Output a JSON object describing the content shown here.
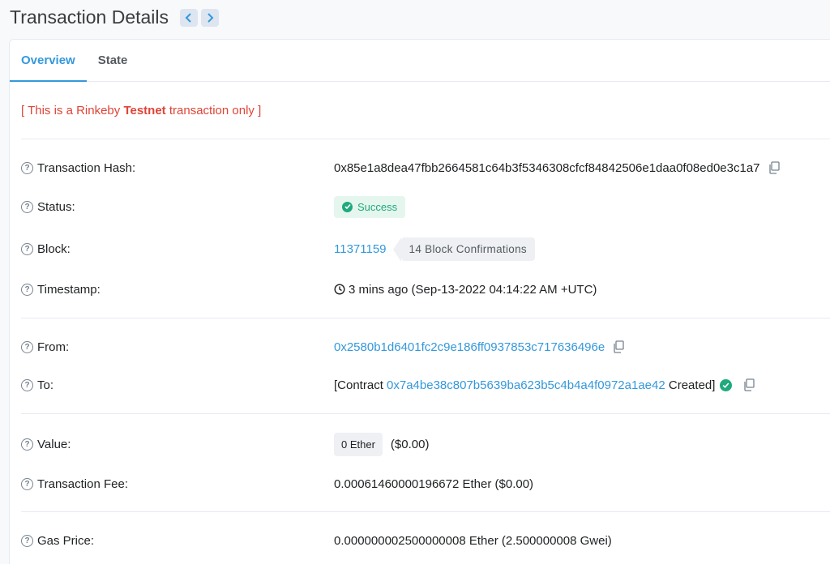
{
  "header": {
    "title": "Transaction Details"
  },
  "tabs": [
    {
      "label": "Overview"
    },
    {
      "label": "State"
    }
  ],
  "notice": {
    "prefix": "[ This is a Rinkeby ",
    "bold": "Testnet",
    "suffix": " transaction only ]"
  },
  "fields": {
    "hash": {
      "label": "Transaction Hash:",
      "value": "0x85e1a8dea47fbb2664581c64b3f5346308cfcf84842506e1daa0f08ed0e3c1a7"
    },
    "status": {
      "label": "Status:",
      "value": "Success"
    },
    "block": {
      "label": "Block:",
      "value": "11371159",
      "confirmations": "14 Block Confirmations"
    },
    "timestamp": {
      "label": "Timestamp:",
      "value": "3 mins ago (Sep-13-2022 04:14:22 AM +UTC)"
    },
    "from": {
      "label": "From:",
      "value": "0x2580b1d6401fc2c9e186ff0937853c717636496e"
    },
    "to": {
      "label": "To:",
      "prefix": "[Contract ",
      "address": "0x7a4be38c807b5639ba623b5c4b4a4f0972a1ae42",
      "suffix": " Created]"
    },
    "value": {
      "label": "Value:",
      "badge": "0 Ether",
      "usd": "($0.00)"
    },
    "fee": {
      "label": "Transaction Fee:",
      "value": "0.00061460000196672 Ether ($0.00)"
    },
    "gas": {
      "label": "Gas Price:",
      "value": "0.000000002500000008 Ether (2.500000008 Gwei)"
    }
  },
  "icons": {
    "help": "?"
  },
  "colors": {
    "link": "#3498db",
    "success": "#1fa97d",
    "notice": "#de4437"
  }
}
